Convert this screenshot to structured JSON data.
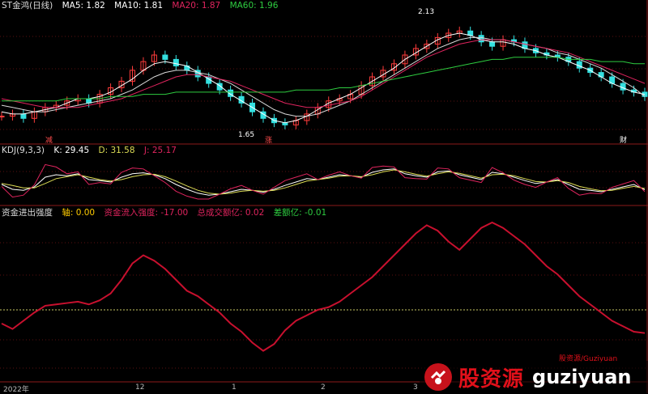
{
  "main_panel": {
    "title": "ST金鸿(日线)",
    "ma": [
      {
        "label": "MA5: 1.82",
        "color": "#ffffff"
      },
      {
        "label": "MA10: 1.81",
        "color": "#ffffff"
      },
      {
        "label": "MA20: 1.87",
        "color": "#e0245e"
      },
      {
        "label": "MA60: 1.96",
        "color": "#2ecc40"
      }
    ],
    "high_label": "2.13",
    "low_label": "1.65",
    "markers": [
      {
        "text": "减",
        "color": "#ff4d4d"
      },
      {
        "text": "涨",
        "color": "#ff4d4d"
      },
      {
        "text": "财",
        "color": "#ffffff"
      }
    ]
  },
  "kdj_panel": {
    "title": "KDJ(9,3,3)",
    "k": "K: 29.45",
    "d": "D: 31.58",
    "j": "J: 25.17",
    "k_color": "#ffffff",
    "d_color": "#dddd55",
    "j_color": "#e0245e"
  },
  "flow_panel": {
    "title": "资金进出强度",
    "items": [
      {
        "label": "轴: 0.00",
        "color": "#ffcc00"
      },
      {
        "label": "资金流入强度: -17.00",
        "color": "#e0245e"
      },
      {
        "label": "总成交额亿: 0.02",
        "color": "#e0245e"
      },
      {
        "label": "差额亿: -0.01",
        "color": "#2ecc40"
      }
    ]
  },
  "x_labels": [
    "2022年",
    "12",
    "1",
    "2",
    "3"
  ],
  "watermark": {
    "cn": "股资源",
    "en": "guziyuan",
    "small": "股资源/Guziyuan"
  },
  "chart_data": [
    {
      "type": "candlestick",
      "title": "ST金鸿(日线)",
      "ylim": [
        1.6,
        2.2
      ],
      "high": 2.13,
      "low": 1.65,
      "close": [
        1.72,
        1.73,
        1.71,
        1.74,
        1.76,
        1.77,
        1.79,
        1.8,
        1.78,
        1.82,
        1.85,
        1.88,
        1.93,
        1.97,
        2.0,
        1.98,
        1.95,
        1.93,
        1.9,
        1.87,
        1.84,
        1.81,
        1.78,
        1.74,
        1.71,
        1.69,
        1.68,
        1.7,
        1.73,
        1.76,
        1.79,
        1.8,
        1.82,
        1.86,
        1.9,
        1.93,
        1.96,
        2.0,
        2.03,
        2.05,
        2.08,
        2.1,
        2.11,
        2.09,
        2.06,
        2.04,
        2.07,
        2.06,
        2.03,
        2.01,
        2.0,
        1.99,
        1.97,
        1.94,
        1.92,
        1.9,
        1.87,
        1.84,
        1.83,
        1.81
      ],
      "series": [
        {
          "name": "MA5",
          "values": [
            1.74,
            1.73,
            1.73,
            1.74,
            1.75,
            1.76,
            1.78,
            1.8,
            1.8,
            1.81,
            1.83,
            1.86,
            1.89,
            1.93,
            1.96,
            1.97,
            1.96,
            1.95,
            1.92,
            1.89,
            1.86,
            1.82,
            1.79,
            1.76,
            1.73,
            1.7,
            1.69,
            1.7,
            1.72,
            1.75,
            1.78,
            1.8,
            1.82,
            1.85,
            1.88,
            1.91,
            1.94,
            1.98,
            2.01,
            2.04,
            2.07,
            2.09,
            2.1,
            2.09,
            2.07,
            2.06,
            2.06,
            2.05,
            2.03,
            2.02,
            2.0,
            1.99,
            1.97,
            1.95,
            1.93,
            1.9,
            1.87,
            1.85,
            1.83,
            1.82
          ]
        },
        {
          "name": "MA10",
          "values": [
            1.77,
            1.76,
            1.75,
            1.74,
            1.74,
            1.75,
            1.76,
            1.77,
            1.78,
            1.79,
            1.8,
            1.82,
            1.84,
            1.87,
            1.9,
            1.92,
            1.93,
            1.93,
            1.92,
            1.91,
            1.89,
            1.87,
            1.84,
            1.81,
            1.78,
            1.75,
            1.73,
            1.72,
            1.72,
            1.73,
            1.75,
            1.77,
            1.79,
            1.82,
            1.85,
            1.88,
            1.91,
            1.94,
            1.97,
            2.0,
            2.03,
            2.05,
            2.07,
            2.08,
            2.08,
            2.07,
            2.07,
            2.06,
            2.05,
            2.04,
            2.03,
            2.01,
            2.0,
            1.98,
            1.96,
            1.94,
            1.91,
            1.88,
            1.85,
            1.81
          ]
        },
        {
          "name": "MA20",
          "values": [
            1.8,
            1.79,
            1.78,
            1.77,
            1.76,
            1.76,
            1.76,
            1.76,
            1.77,
            1.78,
            1.79,
            1.8,
            1.82,
            1.84,
            1.86,
            1.88,
            1.9,
            1.91,
            1.91,
            1.9,
            1.89,
            1.88,
            1.86,
            1.84,
            1.82,
            1.8,
            1.78,
            1.77,
            1.76,
            1.76,
            1.77,
            1.78,
            1.79,
            1.81,
            1.84,
            1.87,
            1.9,
            1.93,
            1.96,
            1.99,
            2.01,
            2.03,
            2.05,
            2.06,
            2.07,
            2.07,
            2.07,
            2.06,
            2.05,
            2.04,
            2.03,
            2.02,
            2.01,
            1.99,
            1.97,
            1.95,
            1.93,
            1.91,
            1.89,
            1.87
          ]
        },
        {
          "name": "MA60",
          "values": [
            1.79,
            1.79,
            1.79,
            1.79,
            1.79,
            1.79,
            1.8,
            1.8,
            1.8,
            1.8,
            1.81,
            1.81,
            1.81,
            1.82,
            1.82,
            1.82,
            1.83,
            1.83,
            1.83,
            1.83,
            1.83,
            1.83,
            1.83,
            1.83,
            1.83,
            1.83,
            1.83,
            1.84,
            1.84,
            1.84,
            1.84,
            1.85,
            1.85,
            1.86,
            1.87,
            1.88,
            1.89,
            1.9,
            1.91,
            1.92,
            1.93,
            1.94,
            1.95,
            1.96,
            1.97,
            1.98,
            1.98,
            1.99,
            1.99,
            1.99,
            1.99,
            1.99,
            1.98,
            1.98,
            1.98,
            1.97,
            1.97,
            1.97,
            1.96,
            1.96
          ]
        }
      ]
    },
    {
      "type": "line",
      "title": "KDJ(9,3,3)",
      "ylim": [
        0,
        100
      ],
      "series": [
        {
          "name": "K",
          "values": [
            40,
            30,
            28,
            35,
            55,
            60,
            58,
            62,
            50,
            48,
            45,
            55,
            62,
            64,
            60,
            52,
            40,
            30,
            22,
            18,
            20,
            25,
            30,
            28,
            24,
            30,
            38,
            45,
            52,
            50,
            55,
            60,
            58,
            55,
            65,
            70,
            72,
            62,
            58,
            55,
            66,
            68,
            60,
            55,
            50,
            65,
            62,
            55,
            48,
            42,
            45,
            50,
            40,
            30,
            28,
            25,
            30,
            35,
            40,
            29
          ]
        },
        {
          "name": "D",
          "values": [
            42,
            38,
            33,
            33,
            42,
            52,
            56,
            60,
            55,
            50,
            47,
            50,
            56,
            60,
            61,
            56,
            47,
            37,
            28,
            22,
            20,
            22,
            26,
            28,
            26,
            28,
            33,
            40,
            47,
            50,
            53,
            57,
            58,
            56,
            60,
            66,
            70,
            66,
            61,
            57,
            62,
            66,
            63,
            58,
            53,
            60,
            61,
            58,
            52,
            46,
            45,
            48,
            44,
            36,
            31,
            27,
            28,
            32,
            36,
            31.58
          ]
        },
        {
          "name": "J",
          "values": [
            36,
            14,
            18,
            39,
            81,
            76,
            62,
            66,
            40,
            44,
            41,
            65,
            74,
            72,
            58,
            44,
            26,
            16,
            10,
            10,
            20,
            31,
            38,
            28,
            20,
            34,
            48,
            55,
            62,
            50,
            59,
            66,
            58,
            53,
            75,
            78,
            76,
            54,
            52,
            51,
            74,
            72,
            54,
            49,
            44,
            75,
            64,
            49,
            40,
            34,
            45,
            54,
            32,
            18,
            22,
            21,
            34,
            41,
            48,
            25.17
          ]
        }
      ]
    },
    {
      "type": "line",
      "title": "资金进出强度",
      "series": [
        {
          "name": "资金流入强度",
          "values": [
            -10,
            -14,
            -8,
            -2,
            3,
            4,
            5,
            6,
            4,
            7,
            12,
            22,
            34,
            40,
            36,
            30,
            22,
            14,
            10,
            4,
            -2,
            -10,
            -16,
            -24,
            -30,
            -25,
            -15,
            -8,
            -4,
            0,
            2,
            6,
            12,
            18,
            24,
            32,
            40,
            48,
            56,
            62,
            58,
            50,
            44,
            52,
            60,
            64,
            60,
            54,
            48,
            40,
            32,
            26,
            18,
            10,
            4,
            -2,
            -8,
            -12,
            -16,
            -17
          ]
        }
      ]
    }
  ]
}
